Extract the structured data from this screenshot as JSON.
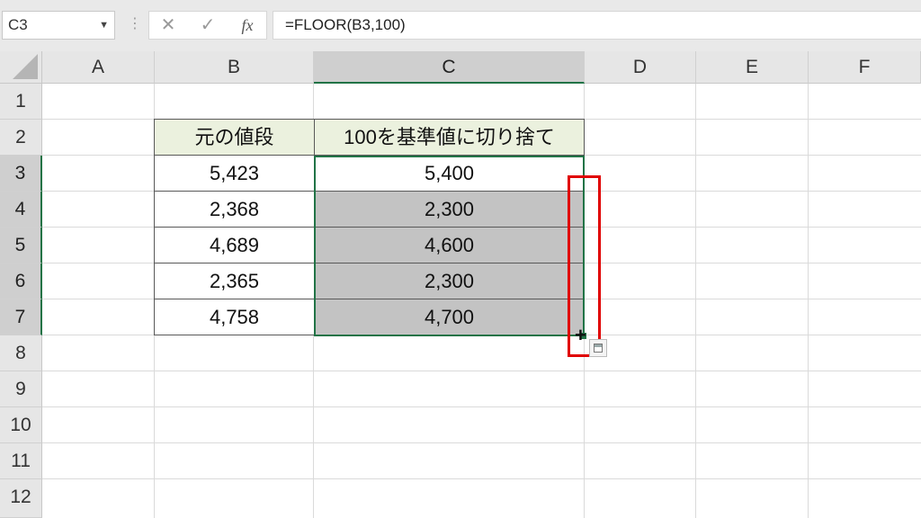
{
  "formula_bar": {
    "name_box": "C3",
    "formula": "=FLOOR(B3,100)",
    "fx_label": "fx",
    "cancel_glyph": "✕",
    "enter_glyph": "✓",
    "dots_glyph": "⋮"
  },
  "columns": [
    "A",
    "B",
    "C",
    "D",
    "E",
    "F"
  ],
  "rows": [
    "1",
    "2",
    "3",
    "4",
    "5",
    "6",
    "7",
    "8",
    "9",
    "10",
    "11",
    "12"
  ],
  "table": {
    "headers": [
      "元の値段",
      "100を基準値に切り捨て"
    ],
    "rows": [
      {
        "original": "5,423",
        "floored": "5,400"
      },
      {
        "original": "2,368",
        "floored": "2,300"
      },
      {
        "original": "4,689",
        "floored": "4,600"
      },
      {
        "original": "2,365",
        "floored": "2,300"
      },
      {
        "original": "4,758",
        "floored": "4,700"
      }
    ]
  },
  "cursor_glyph": "+",
  "colors": {
    "selection": "#217346",
    "highlight": "#e00000",
    "header_fill": "#ebf1de",
    "filled_cells": "#c3c3c3"
  }
}
